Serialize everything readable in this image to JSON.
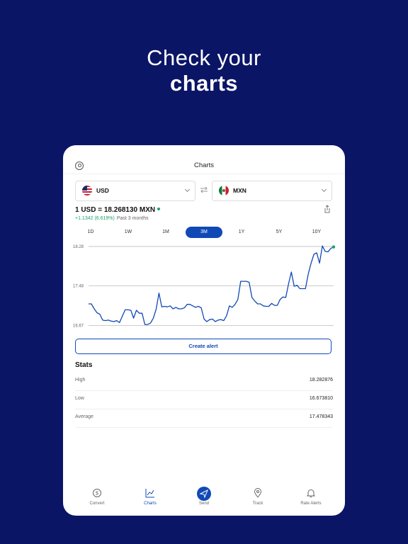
{
  "headline": {
    "line1": "Check your",
    "line2": "charts"
  },
  "screen": {
    "title": "Charts",
    "from_currency": "USD",
    "to_currency": "MXN",
    "rate_text": "1 USD = 18.268130 MXN",
    "change_text": "+1.1342 (6.619%)",
    "period_text": "Past 3 months",
    "ranges": [
      "1D",
      "1W",
      "1M",
      "3M",
      "1Y",
      "5Y",
      "10Y"
    ],
    "active_range": "3M",
    "create_alert_label": "Create alert",
    "stats_title": "Stats",
    "stats": [
      {
        "label": "High",
        "value": "18.282876"
      },
      {
        "label": "Low",
        "value": "16.673810"
      },
      {
        "label": "Average",
        "value": "17.478343"
      }
    ],
    "tabs": [
      {
        "label": "Convert",
        "icon": "dollar-circle-icon"
      },
      {
        "label": "Charts",
        "icon": "chart-line-icon"
      },
      {
        "label": "Send",
        "icon": "paper-plane-icon"
      },
      {
        "label": "Track",
        "icon": "location-pin-icon"
      },
      {
        "label": "Rate Alerts",
        "icon": "bell-icon"
      }
    ],
    "active_tab": "Charts"
  },
  "colors": {
    "background": "#0b1566",
    "accent": "#1049b6",
    "positive": "#1aa36b"
  },
  "chart_data": {
    "type": "line",
    "title": "",
    "ytick_labels": [
      "18.28",
      "17.48",
      "16.67"
    ],
    "yticks": [
      18.28,
      17.48,
      16.67
    ],
    "ylim": [
      16.62,
      18.38
    ],
    "series": [
      {
        "values": [
          17.11,
          17.11,
          17.01,
          16.93,
          16.9,
          16.78,
          16.77,
          16.78,
          16.76,
          16.75,
          16.77,
          16.73,
          16.86,
          16.99,
          16.99,
          16.98,
          16.82,
          16.98,
          16.92,
          16.92,
          16.69,
          16.69,
          16.72,
          16.82,
          17.0,
          17.33,
          17.05,
          17.06,
          17.05,
          17.07,
          17.01,
          17.04,
          17.01,
          17.01,
          17.03,
          17.1,
          17.1,
          17.07,
          17.04,
          17.06,
          17.03,
          16.8,
          16.75,
          16.79,
          16.8,
          16.75,
          16.78,
          16.79,
          16.77,
          16.87,
          17.07,
          17.04,
          17.1,
          17.2,
          17.57,
          17.57,
          17.57,
          17.55,
          17.24,
          17.17,
          17.11,
          17.11,
          17.07,
          17.06,
          17.06,
          17.12,
          17.08,
          17.08,
          17.2,
          17.25,
          17.24,
          17.52,
          17.76,
          17.47,
          17.49,
          17.42,
          17.42,
          17.42,
          17.72,
          17.94,
          18.12,
          18.15,
          17.94,
          18.29,
          18.18,
          18.17,
          18.24,
          18.27
        ]
      }
    ]
  }
}
